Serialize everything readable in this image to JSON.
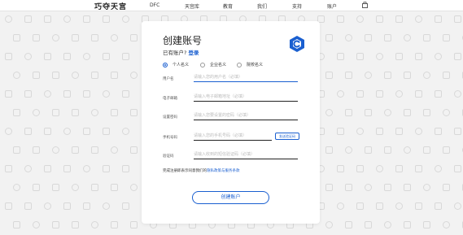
{
  "header": {
    "logo": "巧夺天宫",
    "nav": [
      "DFC",
      "天宫库",
      "教育",
      "我们",
      "支持",
      "账户"
    ]
  },
  "form": {
    "title": "创建账号",
    "have_account_text": "已有账户?",
    "login_link": "登录",
    "account_types": [
      "个人名义",
      "企业名义",
      "院校名义"
    ],
    "selected_account_type": 0,
    "fields": [
      {
        "label": "用户名",
        "placeholder": "请输入您的用户名（必填）"
      },
      {
        "label": "电子邮箱",
        "placeholder": "请输入电子邮箱地址（必填）"
      },
      {
        "label": "设置密码",
        "placeholder": "请输入您要设置的密码（必填）"
      },
      {
        "label": "手机号码",
        "placeholder": "请输入您的手机号码（必填）"
      },
      {
        "label": "验证码",
        "placeholder": "请输入收到的短信验证码（必填）"
      }
    ],
    "verify_button": "发送验证码",
    "terms_prefix": "完成注册即表示同意我们的",
    "terms_link": "隐私政策与服务条款",
    "submit_label": "创建账户"
  },
  "colors": {
    "accent": "#1a5fd0",
    "background": "#f2f2f2"
  }
}
